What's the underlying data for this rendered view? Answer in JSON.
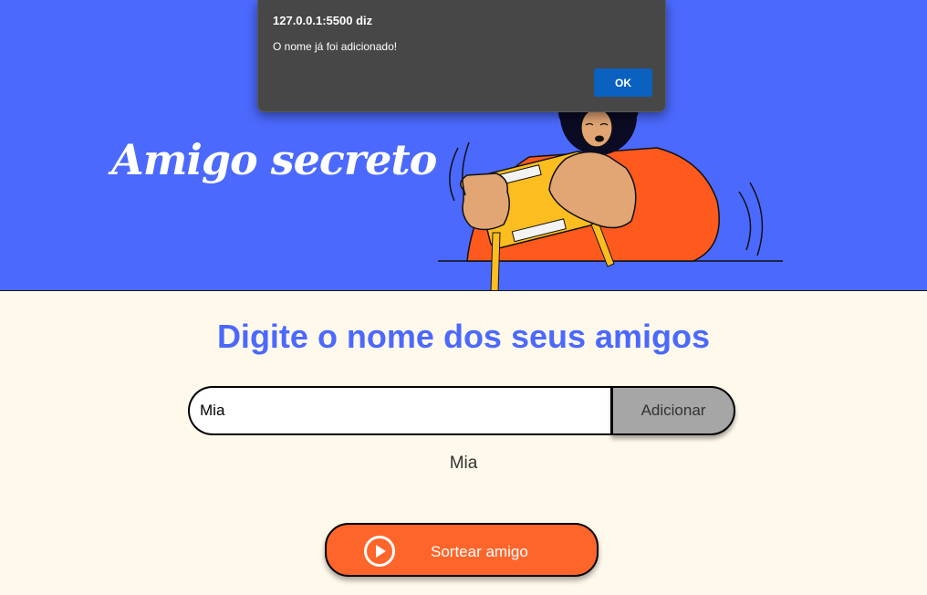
{
  "header": {
    "title": "Amigo secreto"
  },
  "dialog": {
    "origin": "127.0.0.1:5500 diz",
    "message": "O nome já foi adicionado!",
    "ok_label": "OK"
  },
  "main": {
    "subtitle": "Digite o nome dos seus amigos",
    "name_input_value": "Mia",
    "add_button_label": "Adicionar",
    "friends": [
      "Mia"
    ],
    "draw_button_label": "Sortear amigo",
    "draw_icon": "play-circle-icon"
  },
  "colors": {
    "hero_blue": "#4B69FD",
    "page_background": "#FFF9EB",
    "accent_orange": "#FE652B",
    "button_gray": "#A6A6A6",
    "dialog_background": "#474747",
    "dialog_ok_blue": "#0B61C0"
  }
}
